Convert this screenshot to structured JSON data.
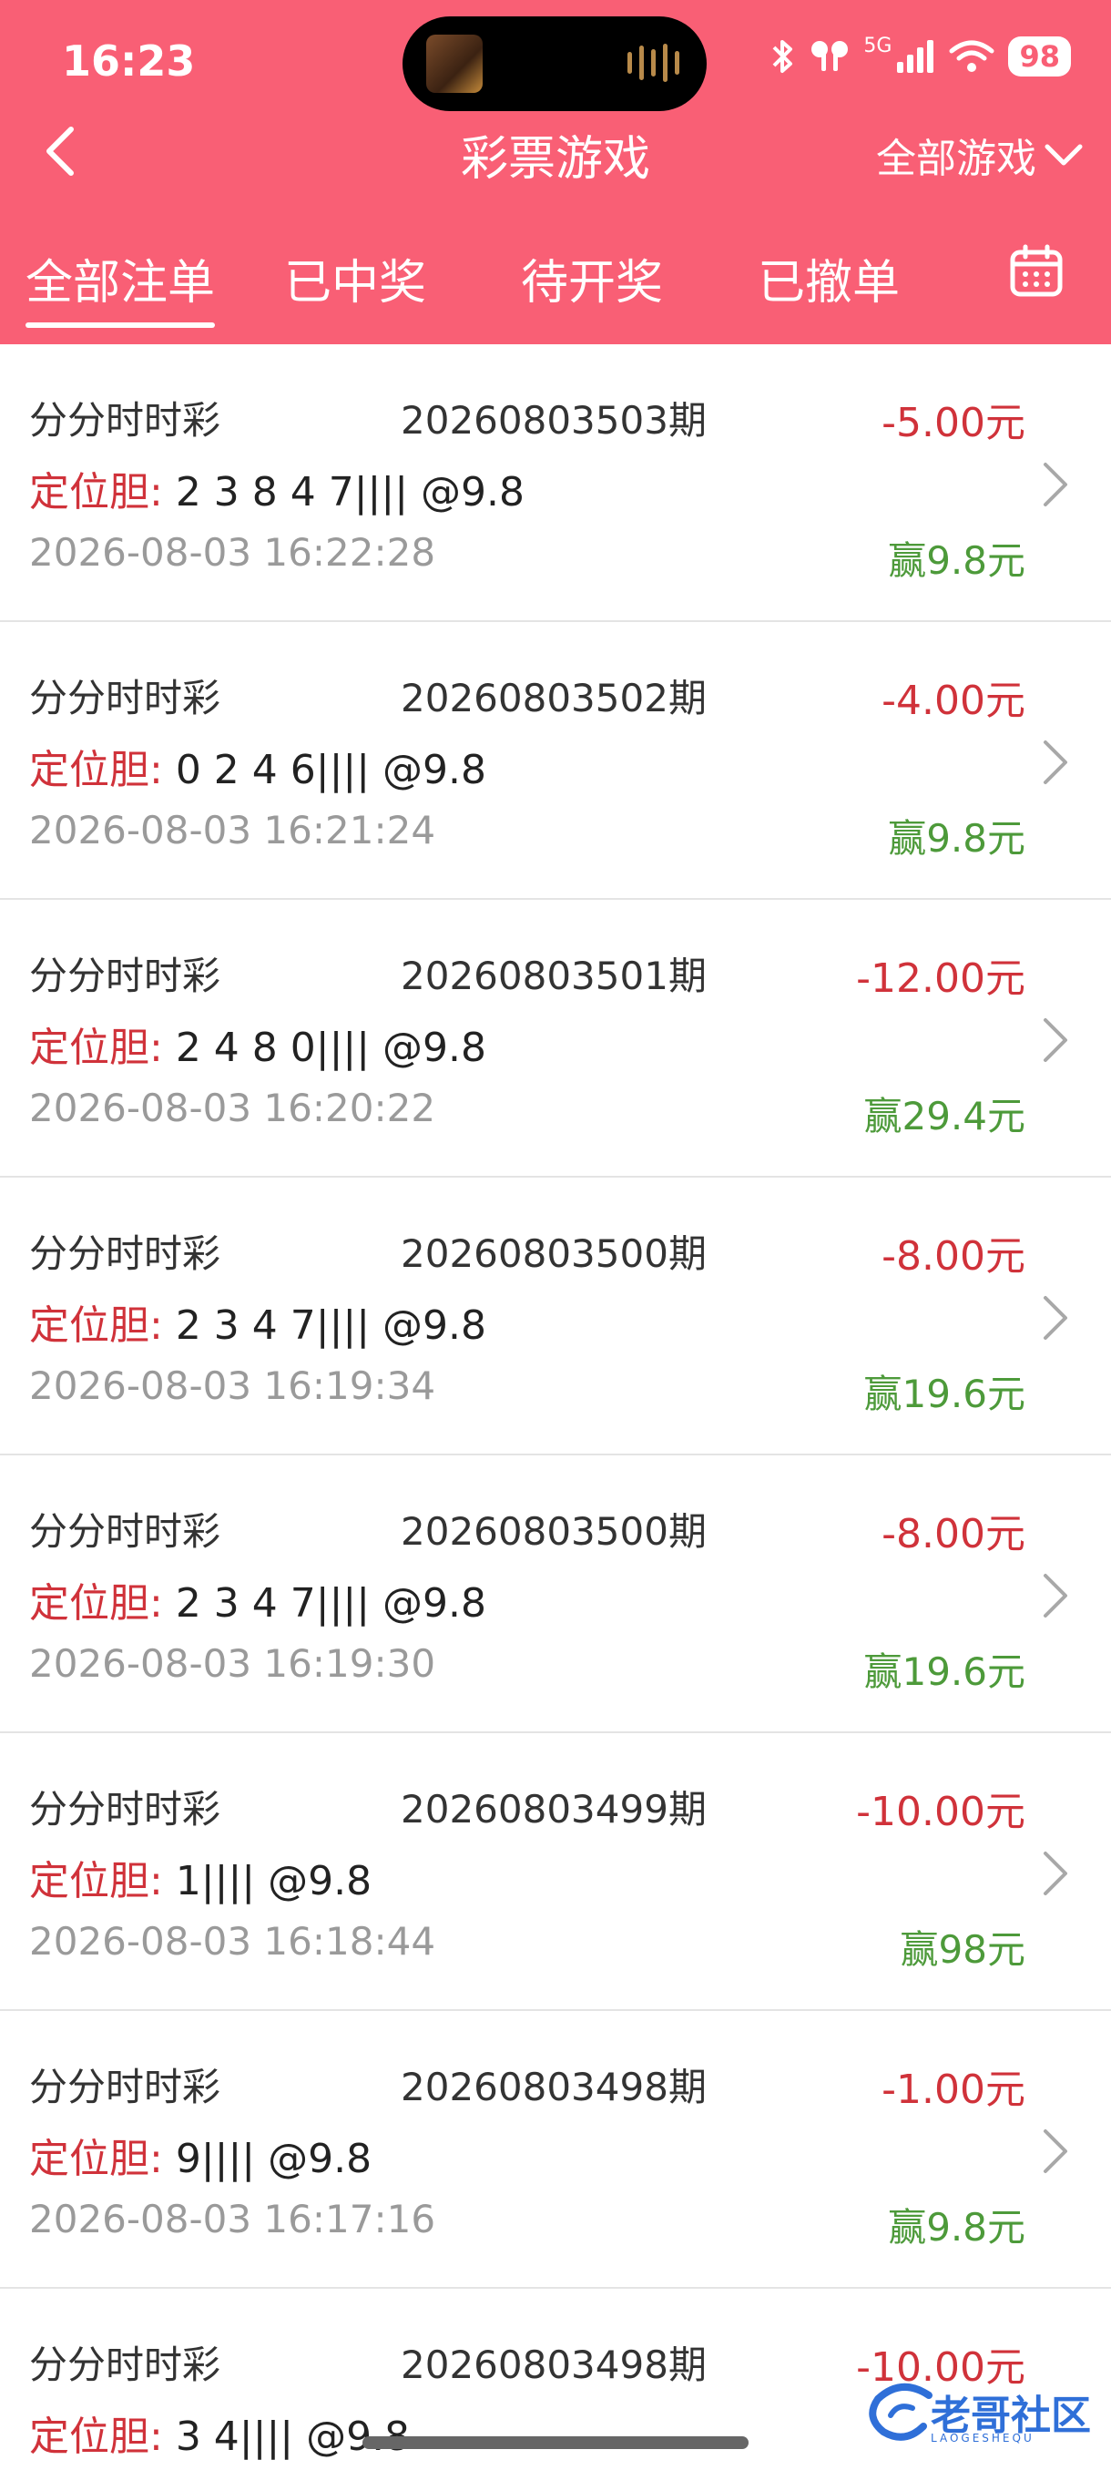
{
  "status_bar": {
    "time": "16:23",
    "network": "5G",
    "battery": "98"
  },
  "nav": {
    "title": "彩票游戏",
    "filter_label": "全部游戏"
  },
  "tabs": [
    {
      "label": "全部注单",
      "active": true
    },
    {
      "label": "已中奖",
      "active": false
    },
    {
      "label": "待开奖",
      "active": false
    },
    {
      "label": "已撤单",
      "active": false
    }
  ],
  "orders": [
    {
      "game": "分分时时彩",
      "issue": "20260803503期",
      "amount": "-5.00元",
      "bet_label": "定位胆:",
      "bet_value": " 2 3 8 4 7|||| @9.8",
      "time": "2026-08-03 16:22:28",
      "win": "赢9.8元"
    },
    {
      "game": "分分时时彩",
      "issue": "20260803502期",
      "amount": "-4.00元",
      "bet_label": "定位胆:",
      "bet_value": " 0 2 4 6|||| @9.8",
      "time": "2026-08-03 16:21:24",
      "win": "赢9.8元"
    },
    {
      "game": "分分时时彩",
      "issue": "20260803501期",
      "amount": "-12.00元",
      "bet_label": "定位胆:",
      "bet_value": " 2 4 8 0|||| @9.8",
      "time": "2026-08-03 16:20:22",
      "win": "赢29.4元"
    },
    {
      "game": "分分时时彩",
      "issue": "20260803500期",
      "amount": "-8.00元",
      "bet_label": "定位胆:",
      "bet_value": " 2 3 4 7|||| @9.8",
      "time": "2026-08-03 16:19:34",
      "win": "赢19.6元"
    },
    {
      "game": "分分时时彩",
      "issue": "20260803500期",
      "amount": "-8.00元",
      "bet_label": "定位胆:",
      "bet_value": " 2 3 4 7|||| @9.8",
      "time": "2026-08-03 16:19:30",
      "win": "赢19.6元"
    },
    {
      "game": "分分时时彩",
      "issue": "20260803499期",
      "amount": "-10.00元",
      "bet_label": "定位胆:",
      "bet_value": " 1|||| @9.8",
      "time": "2026-08-03 16:18:44",
      "win": "赢98元"
    },
    {
      "game": "分分时时彩",
      "issue": "20260803498期",
      "amount": "-1.00元",
      "bet_label": "定位胆:",
      "bet_value": " 9|||| @9.8",
      "time": "2026-08-03 16:17:16",
      "win": "赢9.8元"
    },
    {
      "game": "分分时时彩",
      "issue": "20260803498期",
      "amount": "-10.00元",
      "bet_label": "定位胆:",
      "bet_value": " 3 4|||| @9.8",
      "time": "",
      "win": ""
    }
  ],
  "watermark": {
    "text": "老哥社区",
    "sub": "LAOGESHEQU"
  },
  "colors": {
    "header": "#f95f75",
    "loss": "#d0323a",
    "win": "#4d9a3a",
    "muted": "#9a9a9a"
  }
}
